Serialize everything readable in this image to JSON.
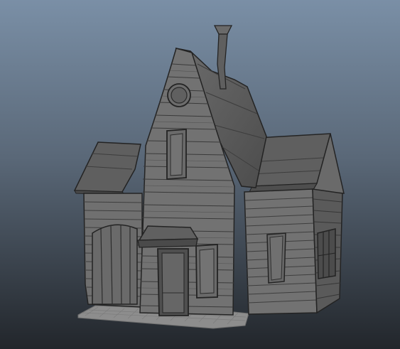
{
  "scene": {
    "subject": "house-model",
    "colors": {
      "bg_top": "#7a8fa6",
      "bg_mid": "#5a6878",
      "bg_bottom": "#22262b",
      "siding": "#6e6e6e",
      "siding_dark": "#5a5a5a",
      "siding_light": "#7b7b7b",
      "roof": "#5f5f5f",
      "roof_dark": "#4a4a4a",
      "roof_light": "#727272",
      "edge": "#232323",
      "plank_line": "#3a3a3a",
      "door": "#666666",
      "ground": "#8d8d8d"
    },
    "icons": {
      "round_window": "round-window-icon",
      "chimney": "chimney-icon"
    }
  }
}
